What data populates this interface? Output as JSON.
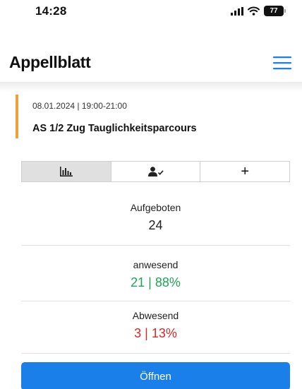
{
  "status_bar": {
    "time": "14:28",
    "battery": "77"
  },
  "header": {
    "title": "Appellblatt"
  },
  "event": {
    "datetime": "08.01.2024 | 19:00-21:00",
    "name": "AS 1/2 Zug Tauglichkeitsparcours"
  },
  "tabs": [
    {
      "icon": "bar-chart-icon",
      "active": true
    },
    {
      "icon": "person-check-icon",
      "active": false
    },
    {
      "icon": "plus-icon",
      "label": "+",
      "active": false
    }
  ],
  "stats": {
    "aufgeboten": {
      "label": "Aufgeboten",
      "value": "24"
    },
    "anwesend": {
      "label": "anwesend",
      "value": "21 | 88%"
    },
    "abwesend": {
      "label": "Abwesend",
      "value": "3 | 13%"
    }
  },
  "colors": {
    "accent": "#1a7fe8",
    "event_marker": "#f0a23a",
    "present": "#1ea354",
    "absent": "#d42a2a"
  },
  "open_button": {
    "label": "Öffnen"
  }
}
